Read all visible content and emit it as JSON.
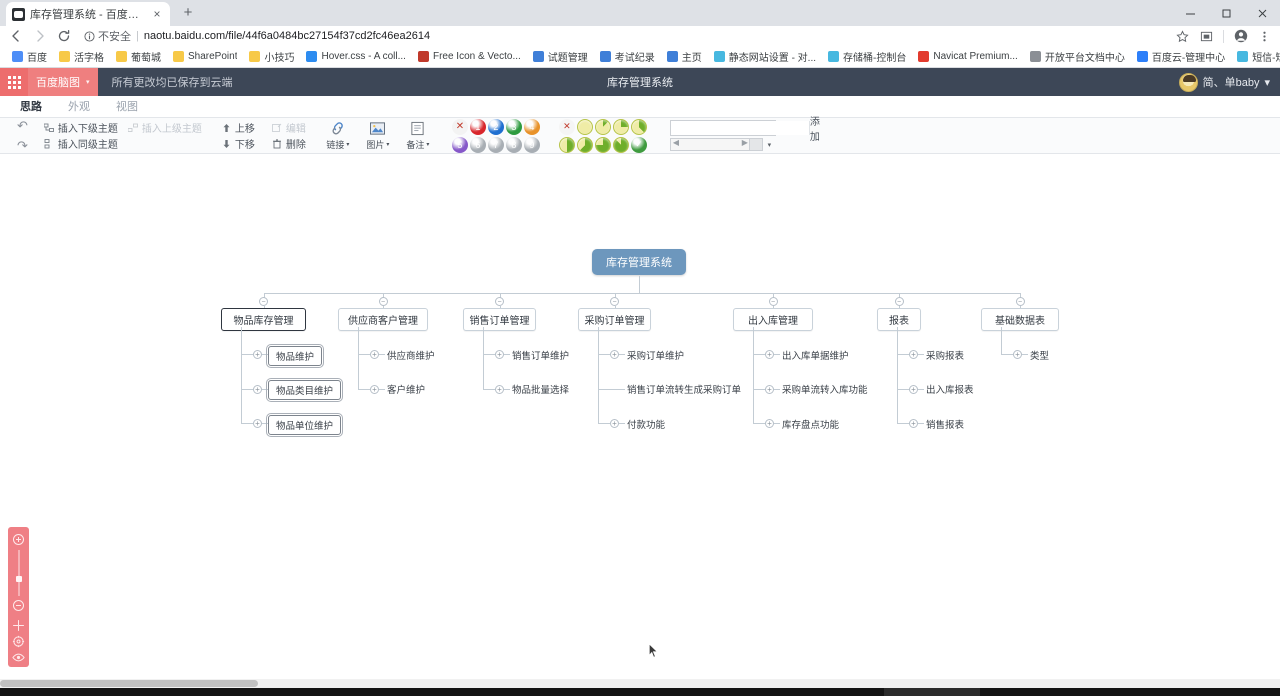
{
  "browser": {
    "tab": {
      "title": "库存管理系统 - 百度脑图",
      "favicon": "naotu-favicon",
      "close": "×"
    },
    "new_tab": "+",
    "window_controls": {
      "minimize": "minimize-icon",
      "maximize": "maximize-icon",
      "close": "close-icon"
    },
    "nav": {
      "back": "←",
      "forward": "→",
      "reload": "↻"
    },
    "security_label": "不安全",
    "url": "naotu.baidu.com/file/44f6a0484bc27154f37cd2fc46ea2614",
    "toolbar_right": [
      "star-icon",
      "cast-icon",
      "profile-icon",
      "menu-icon"
    ],
    "bookmarks": [
      {
        "label": "百度",
        "icon_color": "#4e8ef7"
      },
      {
        "label": "活字格",
        "icon_color": "#f7c948"
      },
      {
        "label": "葡萄城",
        "icon_color": "#f7c948"
      },
      {
        "label": "SharePoint",
        "icon_color": "#f7c948"
      },
      {
        "label": "小技巧",
        "icon_color": "#f7c948"
      },
      {
        "label": "Hover.css - A coll...",
        "icon_color": "#2d8cf0"
      },
      {
        "label": "Free Icon & Vecto...",
        "icon_color": "#c0392b"
      },
      {
        "label": "试题管理",
        "icon_color": "#3f7fd8"
      },
      {
        "label": "考试纪录",
        "icon_color": "#3f7fd8"
      },
      {
        "label": "主页",
        "icon_color": "#3f7fd8"
      },
      {
        "label": "静态网站设置 - 对...",
        "icon_color": "#47b8e0"
      },
      {
        "label": "存储桶-控制台",
        "icon_color": "#47b8e0"
      },
      {
        "label": "Navicat Premium...",
        "icon_color": "#e23b2e"
      },
      {
        "label": "开放平台文档中心",
        "icon_color": "#8b8f95"
      },
      {
        "label": "百度云-管理中心",
        "icon_color": "#2d7ff9"
      },
      {
        "label": "短信-短信签名",
        "icon_color": "#47b8e0"
      }
    ],
    "bookmarks_overflow": "»"
  },
  "app": {
    "apps_button": "apps-grid-icon",
    "brand": "百度脑图",
    "brand_caret": "▾",
    "save_status": "所有更改均已保存到云端",
    "doc_title": "库存管理系统",
    "user": "简、单baby",
    "user_caret": "▾",
    "tabs": [
      {
        "label": "思路",
        "active": true
      },
      {
        "label": "外观",
        "active": false
      },
      {
        "label": "视图",
        "active": false
      }
    ],
    "ribbon": {
      "undo": "↶",
      "redo": "↷",
      "insert": [
        {
          "label": "插入下级主题",
          "dim": false
        },
        {
          "label": "插入上级主题",
          "dim": true
        },
        {
          "label": "插入同级主题",
          "dim": false
        }
      ],
      "move": [
        {
          "label": "上移",
          "icon": "arrow-up-icon",
          "dim": false
        },
        {
          "label": "下移",
          "icon": "arrow-down-icon",
          "dim": false
        }
      ],
      "edit": [
        {
          "label": "编辑",
          "icon": "edit-icon",
          "dim": true
        },
        {
          "label": "删除",
          "icon": "trash-icon",
          "dim": false
        }
      ],
      "big_buttons": [
        {
          "label": "链接",
          "icon": "link-icon",
          "caret": "▾"
        },
        {
          "label": "图片",
          "icon": "image-icon",
          "caret": "▾"
        },
        {
          "label": "备注",
          "icon": "note-icon",
          "caret": "▾"
        }
      ],
      "priority": [
        {
          "label": "✕",
          "color": "#f3f3f3",
          "none": true
        },
        {
          "label": "1",
          "color": "#d8262c"
        },
        {
          "label": "2",
          "color": "#1f6fd0"
        },
        {
          "label": "3",
          "color": "#2e9b3f"
        },
        {
          "label": "4",
          "color": "#e8922a"
        },
        {
          "label": "5",
          "color": "#8658c9"
        },
        {
          "label": "6",
          "color": "#a8aeb4"
        },
        {
          "label": "7",
          "color": "#a8aeb4"
        },
        {
          "label": "8",
          "color": "#a8aeb4"
        },
        {
          "label": "9",
          "color": "#a8aeb4"
        }
      ],
      "progress": [
        {
          "name": "progress-none",
          "pct": -1
        },
        {
          "name": "progress-0",
          "pct": 0
        },
        {
          "name": "progress-1-8",
          "pct": 12
        },
        {
          "name": "progress-2-8",
          "pct": 25
        },
        {
          "name": "progress-3-8",
          "pct": 38
        },
        {
          "name": "progress-4-8",
          "pct": 50
        },
        {
          "name": "progress-5-8",
          "pct": 62
        },
        {
          "name": "progress-6-8",
          "pct": 75
        },
        {
          "name": "progress-7-8",
          "pct": 88
        },
        {
          "name": "progress-done",
          "pct": 100
        }
      ],
      "tag_input_value": "",
      "tag_add_label": "添加",
      "tag_caret": "▾"
    }
  },
  "mindmap": {
    "root": {
      "label": "库存管理系统"
    },
    "branches": [
      {
        "label": "物品库存管理",
        "toggle": "−",
        "children": [
          {
            "label": "物品维护",
            "toggle": "+",
            "boxed": true
          },
          {
            "label": "物品类目维护",
            "toggle": "+",
            "boxed": true
          },
          {
            "label": "物品单位维护",
            "toggle": "+",
            "boxed": true
          }
        ]
      },
      {
        "label": "供应商客户管理",
        "toggle": "−",
        "children": [
          {
            "label": "供应商维护",
            "toggle": "+",
            "boxed": false
          },
          {
            "label": "客户维护",
            "toggle": "+",
            "boxed": false
          }
        ]
      },
      {
        "label": "销售订单管理",
        "toggle": "−",
        "children": [
          {
            "label": "销售订单维护",
            "toggle": "+",
            "boxed": false
          },
          {
            "label": "物品批量选择",
            "toggle": "+",
            "boxed": false
          }
        ]
      },
      {
        "label": "采购订单管理",
        "toggle": "−",
        "children": [
          {
            "label": "采购订单维护",
            "toggle": "+",
            "boxed": false
          },
          {
            "label": "销售订单流转生成采购订单",
            "toggle": "",
            "boxed": false
          },
          {
            "label": "付款功能",
            "toggle": "+",
            "boxed": false
          }
        ]
      },
      {
        "label": "出入库管理",
        "toggle": "−",
        "children": [
          {
            "label": "出入库单据维护",
            "toggle": "+",
            "boxed": false
          },
          {
            "label": "采购单流转入库功能",
            "toggle": "+",
            "boxed": false
          },
          {
            "label": "库存盘点功能",
            "toggle": "+",
            "boxed": false
          }
        ]
      },
      {
        "label": "报表",
        "toggle": "−",
        "children": [
          {
            "label": "采购报表",
            "toggle": "+",
            "boxed": false
          },
          {
            "label": "出入库报表",
            "toggle": "+",
            "boxed": false
          },
          {
            "label": "销售报表",
            "toggle": "+",
            "boxed": false
          }
        ]
      },
      {
        "label": "基础数据表",
        "toggle": "−",
        "children": [
          {
            "label": "类型",
            "toggle": "+",
            "boxed": false
          }
        ]
      }
    ]
  },
  "zoom_panel": {
    "zoom_in": "zoom-in-icon",
    "zoom_out": "zoom-out-icon",
    "move": "move-icon",
    "fit": "fit-icon",
    "eye": "eye-icon",
    "accent": "#ef7f85"
  },
  "colors": {
    "root_node": "#6d97bd",
    "app_header": "#3d4757",
    "brand": "#ef7f7f",
    "line": "#c3ccd4"
  }
}
